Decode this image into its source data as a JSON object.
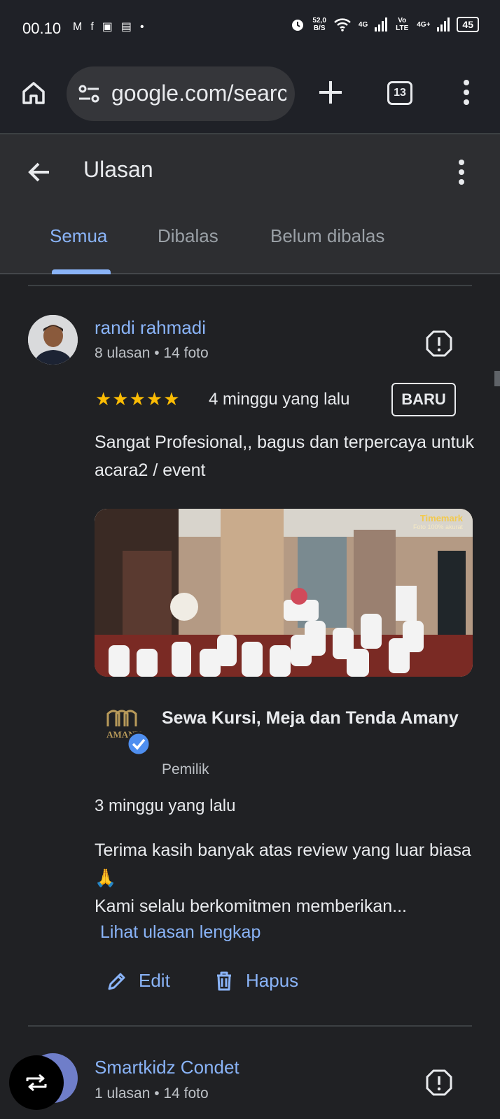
{
  "status_bar": {
    "time": "00.10",
    "left_icons": [
      "gmail-icon",
      "facebook-icon",
      "briefcase-icon",
      "app-icon",
      "dot-icon"
    ],
    "net_speed": "52,0",
    "net_unit": "B/S",
    "signal1": "4G",
    "volte": "Vo LTE",
    "signal2": "4G+",
    "battery": "45"
  },
  "browser": {
    "url": "google.com/search",
    "tab_count": "13"
  },
  "header": {
    "title": "Ulasan",
    "tabs": [
      {
        "label": "Semua",
        "active": true
      },
      {
        "label": "Dibalas",
        "active": false
      },
      {
        "label": "Belum dibalas",
        "active": false
      }
    ]
  },
  "review": {
    "author": "randi rahmadi",
    "meta": "8 ulasan • 14 foto",
    "stars": "★★★★★",
    "rating": 5,
    "time": "4 minggu yang lalu",
    "badge": "BARU",
    "text": "Sangat Profesional,, bagus dan terpercaya untuk acara2 / event",
    "photo_watermark": "Timemark",
    "photo_watermark_sub": "Foto 100% akurat"
  },
  "reply": {
    "owner_name": "Sewa Kursi, Meja dan Tenda Amany",
    "owner_role": "Pemilik",
    "logo_text": "AMANY",
    "time": "3 minggu yang lalu",
    "text_line1": "Terima kasih banyak atas review yang luar biasa 🙏",
    "text_line2": "Kami selalu berkomitmen memberikan...",
    "more_label": "Lihat ulasan lengkap"
  },
  "actions": {
    "edit_label": "Edit",
    "delete_label": "Hapus"
  },
  "review2": {
    "author": "Smartkidz Condet",
    "meta": "1 ulasan • 14 foto"
  },
  "colors": {
    "background": "#202124",
    "accent": "#8ab4f8",
    "star": "#fbbc04"
  }
}
